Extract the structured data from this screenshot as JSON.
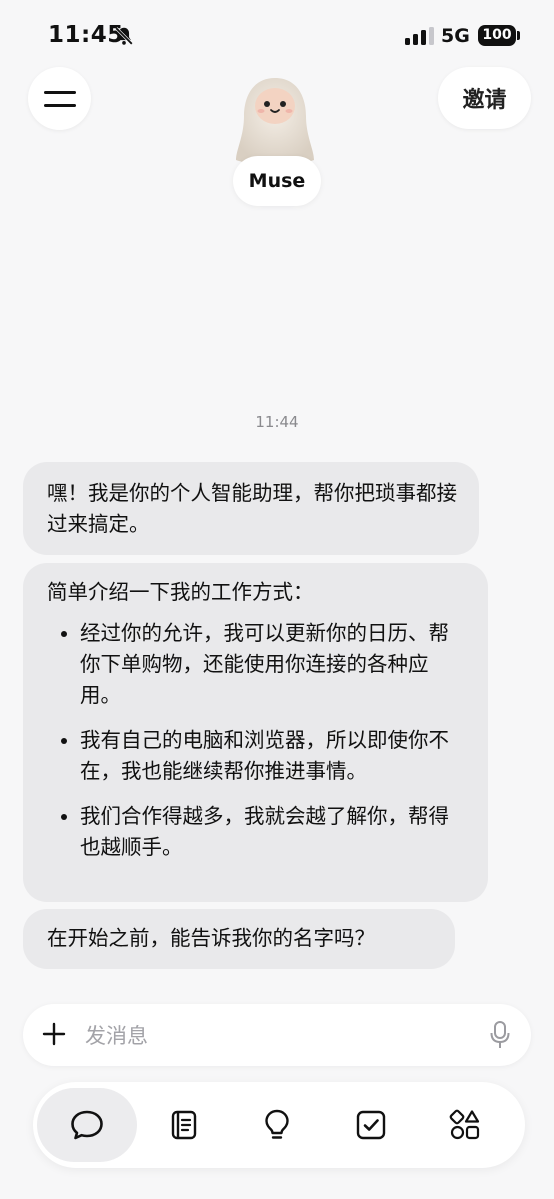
{
  "status_bar": {
    "time": "11:45",
    "network": "5G",
    "battery": "100"
  },
  "header": {
    "invite_label": "邀请",
    "assistant_name": "Muse"
  },
  "chat": {
    "timestamp": "11:44",
    "messages": [
      {
        "text": "嘿！我是你的个人智能助理，帮你把琐事都接过来搞定。"
      },
      {
        "intro": "简单介绍一下我的工作方式：",
        "bullets": [
          "经过你的允许，我可以更新你的日历、帮你下单购物，还能使用你连接的各种应用。",
          "我有自己的电脑和浏览器，所以即使你不在，我也能继续帮你推进事情。",
          "我们合作得越多，我就会越了解你，帮得也越顺手。"
        ]
      },
      {
        "text": "在开始之前，能告诉我你的名字吗？"
      }
    ]
  },
  "composer": {
    "placeholder": "发消息",
    "value": ""
  },
  "nav": {
    "items": [
      {
        "icon": "chat-bubble-icon",
        "active": true
      },
      {
        "icon": "notes-icon",
        "active": false
      },
      {
        "icon": "lightbulb-icon",
        "active": false
      },
      {
        "icon": "checkbox-icon",
        "active": false
      },
      {
        "icon": "shapes-icon",
        "active": false
      }
    ]
  }
}
